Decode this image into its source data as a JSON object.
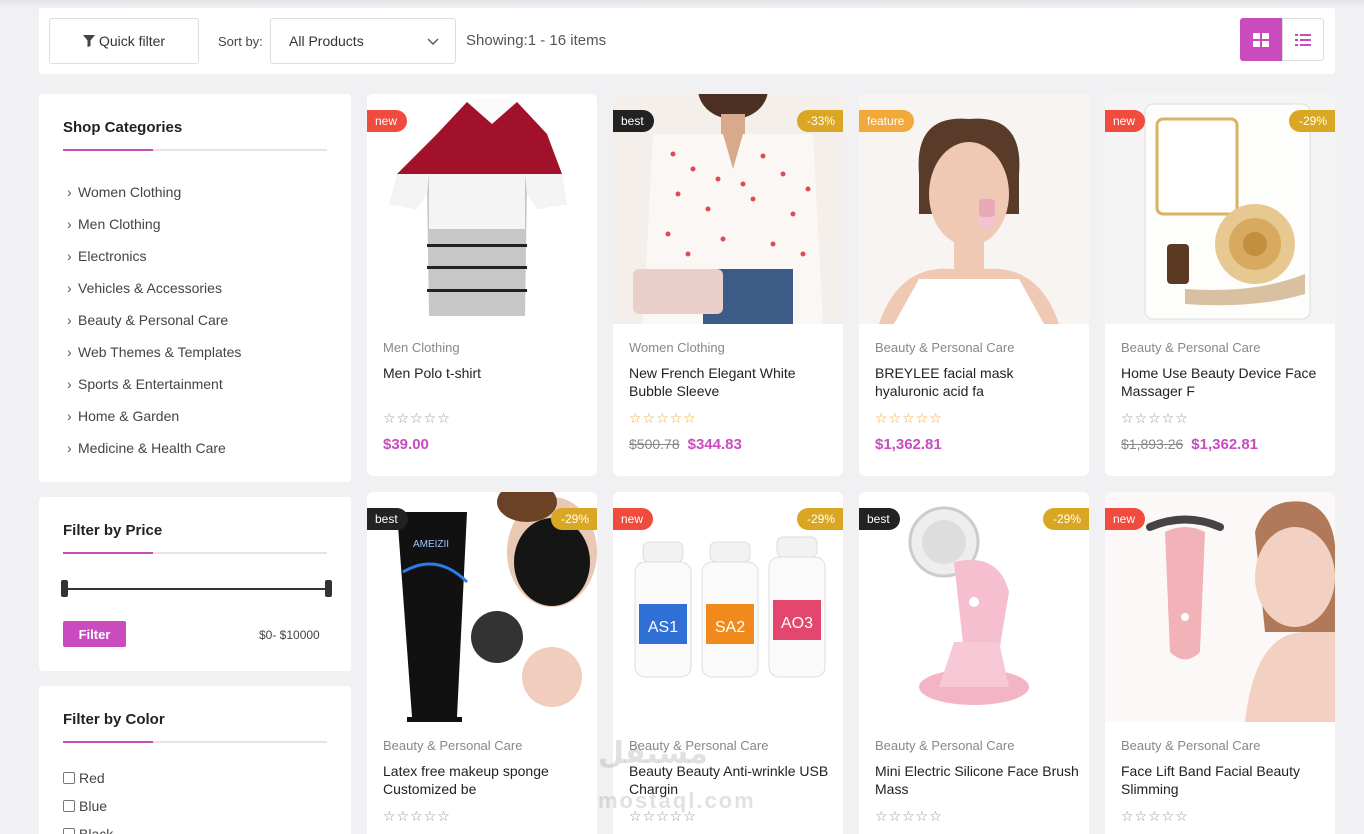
{
  "toolbar": {
    "quick_filter": "Quick filter",
    "sort_label": "Sort by:",
    "sort_value": "All Products",
    "showing": "Showing:1 - 16 items"
  },
  "categories_widget": {
    "title": "Shop Categories",
    "items": [
      "Women Clothing",
      "Men Clothing",
      "Electronics",
      "Vehicles & Accessories",
      "Beauty & Personal Care",
      "Web Themes & Templates",
      "Sports & Entertainment",
      "Home & Garden",
      "Medicine & Health Care"
    ]
  },
  "price_widget": {
    "title": "Filter by Price",
    "button": "Filter",
    "range": "$0- $10000"
  },
  "color_widget": {
    "title": "Filter by Color",
    "items": [
      "Red",
      "Blue",
      "Black"
    ]
  },
  "products": [
    {
      "badge": "new",
      "discount": "",
      "category": "Men Clothing",
      "title": "Men Polo t-shirt",
      "old_price": "",
      "price": "$39.00",
      "star_color": "#999"
    },
    {
      "badge": "best",
      "discount": "-33%",
      "category": "Women Clothing",
      "title": "New French Elegant White Bubble Sleeve",
      "old_price": "$500.78",
      "price": "$344.83",
      "star_color": "#f2a83a"
    },
    {
      "badge": "feature",
      "discount": "",
      "category": "Beauty & Personal Care",
      "title": "BREYLEE facial mask hyaluronic acid fa",
      "old_price": "",
      "price": "$1,362.81",
      "star_color": "#f2a83a"
    },
    {
      "badge": "new",
      "discount": "-29%",
      "category": "Beauty & Personal Care",
      "title": "Home Use Beauty Device Face Massager F",
      "old_price": "$1,893.26",
      "price": "$1,362.81",
      "star_color": "#999"
    },
    {
      "badge": "best",
      "discount": "-29%",
      "category": "Beauty & Personal Care",
      "title": "Latex free makeup sponge Customized be",
      "old_price": "",
      "price": "",
      "star_color": "#999"
    },
    {
      "badge": "new",
      "discount": "-29%",
      "category": "Beauty & Personal Care",
      "title": "Beauty Beauty Anti-wrinkle USB Chargin",
      "old_price": "",
      "price": "",
      "star_color": "#999"
    },
    {
      "badge": "best",
      "discount": "-29%",
      "category": "Beauty & Personal Care",
      "title": "Mini Electric Silicone Face Brush Mass",
      "old_price": "",
      "price": "",
      "star_color": "#999"
    },
    {
      "badge": "new",
      "discount": "",
      "category": "Beauty & Personal Care",
      "title": "Face Lift Band Facial Beauty Slimming",
      "old_price": "",
      "price": "",
      "star_color": "#999"
    }
  ],
  "stars": "☆☆☆☆☆",
  "watermark": {
    "arabic": "مستقل",
    "latin": "mostaql.com"
  },
  "colors": {
    "accent": "#c94bbf",
    "new": "#f04b3c",
    "best": "#222222",
    "feature": "#f2a83a",
    "discount": "#d9a723"
  }
}
